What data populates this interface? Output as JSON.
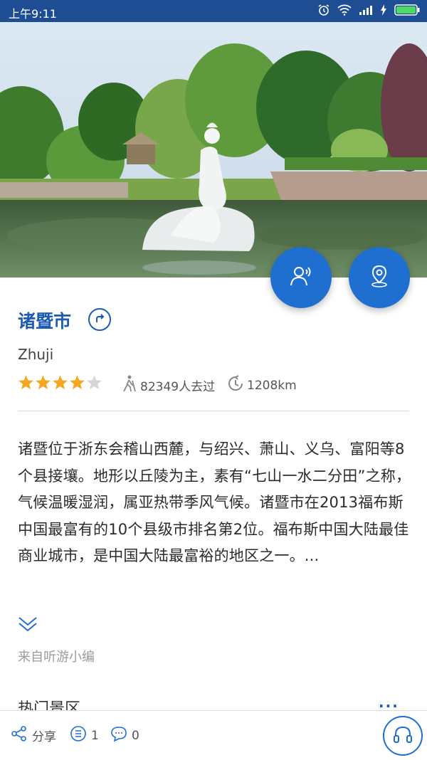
{
  "status_bar": {
    "time": "上午9:11",
    "icons": [
      "alarm-icon",
      "wifi-icon",
      "signal-icon",
      "charging-icon",
      "battery-icon"
    ]
  },
  "hero": {
    "image": "statue-park-photo"
  },
  "actions": {
    "guide_icon": "audio-guide-person-icon",
    "location_icon": "location-pin-icon"
  },
  "place": {
    "name": "诸暨市",
    "name_en": "Zhuji",
    "rating": 4,
    "rating_max": 5,
    "visits": "82349人去过",
    "distance": "1208km"
  },
  "description": {
    "text": "诸暨位于浙东会稽山西麓，与绍兴、萧山、义乌、富阳等8个县接壤。地形以丘陵为主，素有“七山一水二分田”之称，气候温暖湿润，属亚热带季风气候。诸暨市在2013福布斯中国最富有的10个县级市排名第2位。福布斯中国大陆最佳商业城市，是中国大陆最富裕的地区之一。...",
    "source": "来自听游小编"
  },
  "sections": {
    "hot_areas_title": "热门景区",
    "more": "···"
  },
  "bottom_bar": {
    "share_label": "分享",
    "list_count": "1",
    "comment_count": "0"
  },
  "colors": {
    "status_bar": "#1e4d93",
    "accent": "#1e6fd0",
    "title": "#1e5bb1",
    "star": "#f5a623"
  }
}
